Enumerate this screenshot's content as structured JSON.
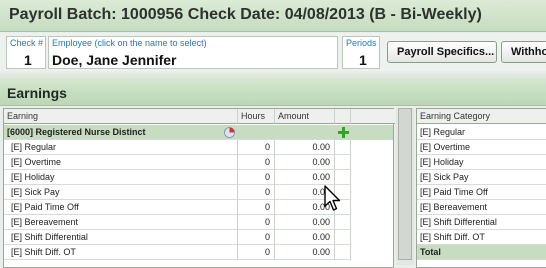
{
  "title": "Payroll Batch: 1000956 Check Date: 04/08/2013 (B - Bi-Weekly)",
  "check": {
    "label": "Check #",
    "value": "1"
  },
  "employee": {
    "label": "Employee (click on the name to select)",
    "value": "Doe, Jane Jennifer"
  },
  "periods": {
    "label": "Periods",
    "value": "1"
  },
  "buttons": {
    "payroll_specifics": "Payroll Specifics...",
    "withholding": "Withho"
  },
  "earnings": {
    "title": "Earnings",
    "columns": {
      "earning": "Earning",
      "hours": "Hours",
      "amount": "Amount"
    },
    "group": "[6000] Registered Nurse Distinct",
    "rows": [
      {
        "name": "[E] Regular",
        "hours": "0",
        "amount": "0.00"
      },
      {
        "name": "[E] Overtime",
        "hours": "0",
        "amount": "0.00"
      },
      {
        "name": "[E] Holiday",
        "hours": "0",
        "amount": "0.00"
      },
      {
        "name": "[E] Sick Pay",
        "hours": "0",
        "amount": "0.00"
      },
      {
        "name": "[E] Paid Time Off",
        "hours": "0",
        "amount": "0.00"
      },
      {
        "name": "[E] Bereavement",
        "hours": "0",
        "amount": "0.00"
      },
      {
        "name": "[E] Shift Differential",
        "hours": "0",
        "amount": "0.00"
      },
      {
        "name": "[E] Shift Diff. OT",
        "hours": "0",
        "amount": "0.00"
      }
    ]
  },
  "category": {
    "header": "Earning Category",
    "rows": [
      "[E] Regular",
      "[E] Overtime",
      "[E] Holiday",
      "[E] Sick Pay",
      "[E] Paid Time Off",
      "[E] Bereavement",
      "[E] Shift Differential",
      "[E] Shift Diff. OT"
    ],
    "total": "Total"
  },
  "colors": {
    "accent_green": "#2fa52f",
    "label_blue": "#1f79b5",
    "group_row": "#c7dcc1"
  },
  "icons": {
    "pie": "pie-chart-icon",
    "add": "plus-icon",
    "cursor": "mouse-pointer-icon"
  }
}
